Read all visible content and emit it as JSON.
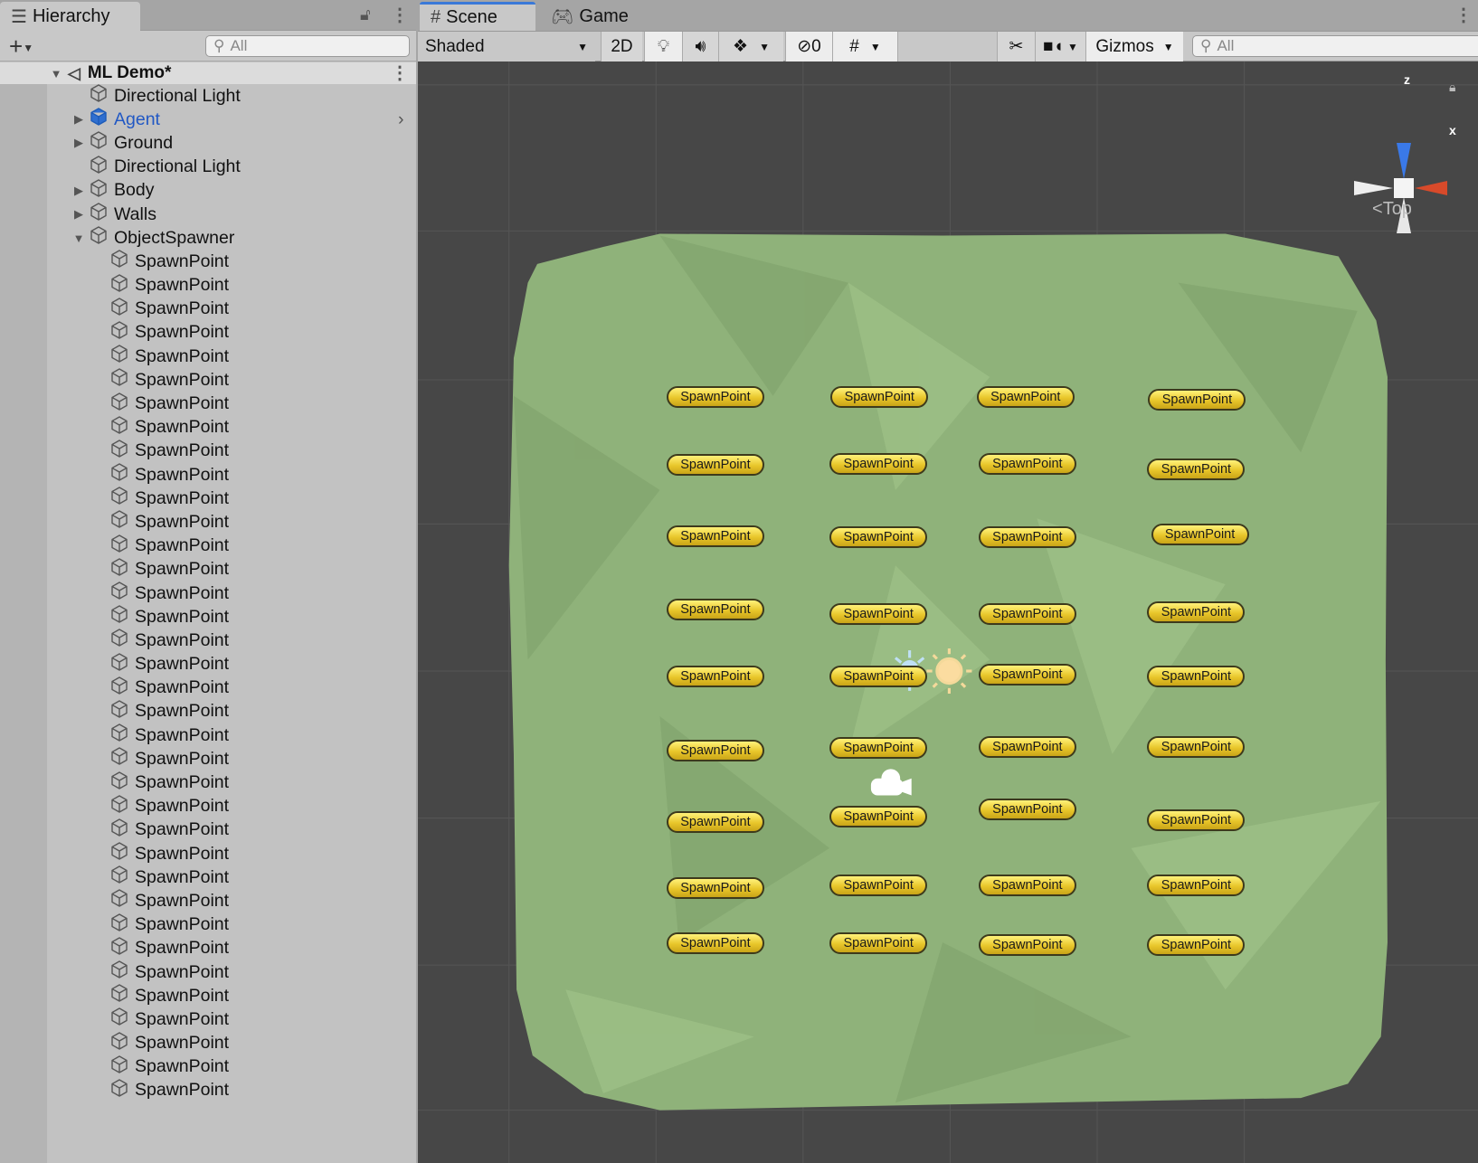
{
  "hierarchy": {
    "tab_label": "Hierarchy",
    "search_placeholder": "All",
    "scene_name": "ML Demo*",
    "items": [
      {
        "label": "Directional Light",
        "depth": 1,
        "expand": "none",
        "selected_color": false
      },
      {
        "label": "Agent",
        "depth": 1,
        "expand": "collapsed",
        "highlight": true
      },
      {
        "label": "Ground",
        "depth": 1,
        "expand": "collapsed"
      },
      {
        "label": "Directional Light",
        "depth": 1,
        "expand": "none"
      },
      {
        "label": "Body",
        "depth": 1,
        "expand": "collapsed"
      },
      {
        "label": "Walls",
        "depth": 1,
        "expand": "collapsed"
      },
      {
        "label": "ObjectSpawner",
        "depth": 1,
        "expand": "expanded"
      }
    ],
    "spawn_label": "SpawnPoint",
    "spawn_count": 36
  },
  "scene": {
    "tabs": [
      {
        "label": "Scene",
        "active": true
      },
      {
        "label": "Game",
        "active": false
      }
    ],
    "shading_mode": "Shaded",
    "mode_2d": "2D",
    "hidden_count": "0",
    "gizmos_label": "Gizmos",
    "search_placeholder": "All",
    "view_label": "Top",
    "axis_z": "z",
    "axis_x": "x",
    "spawn_label": "SpawnPoint",
    "colors": {
      "ground": "#8fb27a",
      "background": "#474747",
      "accent": "#3a79d8",
      "agent": "#2f6fd0"
    }
  }
}
